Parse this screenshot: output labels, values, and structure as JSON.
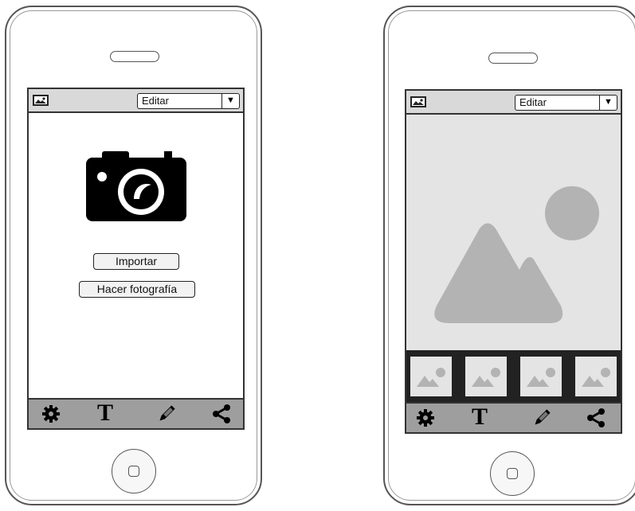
{
  "phone_left": {
    "topbar": {
      "icon": "image-icon",
      "select_value": "Editar",
      "select_arrow": "▼"
    },
    "camera_icon": "camera-icon",
    "buttons": {
      "import_label": "Importar",
      "photo_label": "Hacer fotografía"
    },
    "bottombar": {
      "icons": [
        "gear-icon",
        "text-icon",
        "pencil-icon",
        "share-icon"
      ],
      "text_glyph": "T"
    }
  },
  "phone_right": {
    "topbar": {
      "icon": "image-icon",
      "select_value": "Editar",
      "select_arrow": "▼"
    },
    "main_image": "image-placeholder-icon",
    "thumbnails": [
      "image-thumbnail-icon",
      "image-thumbnail-icon",
      "image-thumbnail-icon",
      "image-thumbnail-icon"
    ],
    "bottombar": {
      "icons": [
        "gear-icon",
        "text-icon",
        "pencil-icon",
        "share-icon"
      ],
      "text_glyph": "T"
    }
  },
  "colors": {
    "bar": "#d9d9d9",
    "toolbar": "#9e9e9e",
    "placeholder": "#e4e4e4",
    "placeholder_shape": "#b3b3b3",
    "thumb_strip": "#222222"
  }
}
